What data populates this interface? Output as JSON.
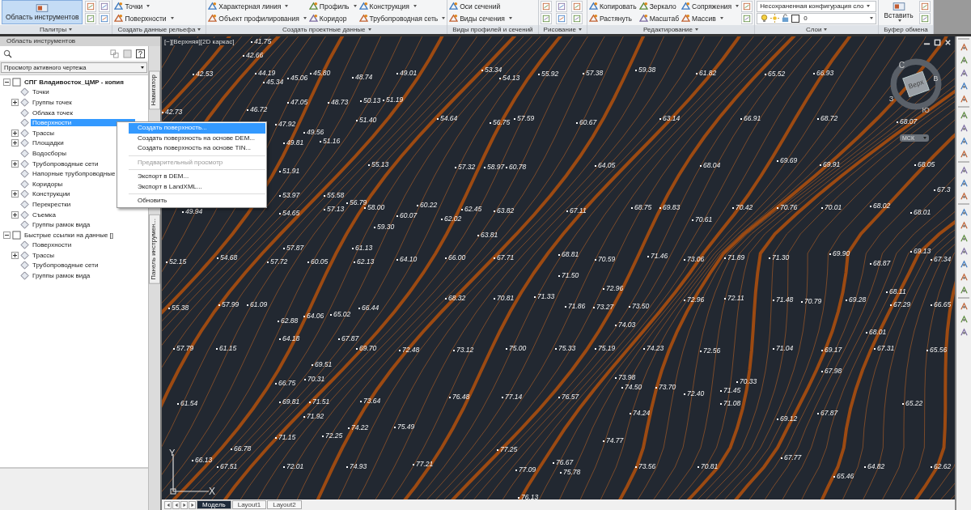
{
  "ribbon": {
    "panels": [
      {
        "title": "Палитры",
        "menu": true,
        "items": [
          {
            "label": "Область инструментов",
            "kind": "large",
            "selected": true,
            "dropdown": false
          }
        ]
      },
      {
        "title": "Создать данные рельефа",
        "menu": true,
        "items": [
          {
            "label": "Точки",
            "kind": "small",
            "dropdown": true
          },
          {
            "label": "Поверхности",
            "kind": "small",
            "dropdown": true
          }
        ]
      },
      {
        "title": "Создать проектные данные",
        "menu": true,
        "items": [
          {
            "label": "Характерная линия",
            "kind": "small",
            "dropdown": true
          },
          {
            "label": "Объект профилирования",
            "kind": "small",
            "dropdown": true
          },
          {
            "label": "Профиль",
            "kind": "small",
            "dropdown": true
          },
          {
            "label": "Коридор",
            "kind": "small",
            "dropdown": false
          },
          {
            "label": "Конструкция",
            "kind": "small",
            "dropdown": true
          },
          {
            "label": "Трубопроводная сеть",
            "kind": "small",
            "dropdown": true
          }
        ]
      },
      {
        "title": "Виды профилей и сечений",
        "menu": false,
        "items": [
          {
            "label": "Оси сечений",
            "kind": "small",
            "dropdown": false
          },
          {
            "label": "Виды сечения",
            "kind": "small",
            "dropdown": true
          }
        ]
      },
      {
        "title": "Рисование",
        "menu": true
      },
      {
        "title": "Редактирование",
        "menu": true,
        "items": [
          {
            "label": "Копировать",
            "kind": "small",
            "dropdown": false
          },
          {
            "label": "Растянуть",
            "kind": "small",
            "dropdown": false
          },
          {
            "label": "Зеркало",
            "kind": "small",
            "dropdown": false
          },
          {
            "label": "Масштаб",
            "kind": "small",
            "dropdown": false
          },
          {
            "label": "Сопряжения",
            "kind": "small",
            "dropdown": true
          },
          {
            "label": "Массив",
            "kind": "small",
            "dropdown": true
          }
        ]
      },
      {
        "title": "Слои",
        "menu": true,
        "items": [
          {
            "label": "Несохраненная конфигурация сло",
            "kind": "combo",
            "dropdown": true
          },
          {
            "label": "0",
            "kind": "layer",
            "dropdown": true
          }
        ]
      },
      {
        "title": "Буфер обмена",
        "menu": false,
        "items": [
          {
            "label": "Вставить",
            "kind": "large",
            "selected": false,
            "dropdown": true
          }
        ]
      }
    ]
  },
  "palette": {
    "title": "Область инструментов",
    "view_select": "Просмотр активного чертежа",
    "side_tabs": [
      "Навигатор",
      "Панель инструмен..."
    ],
    "tree": [
      {
        "label": "СПГ Владивосток_ЦМР - копия",
        "kind": "drawing",
        "expanded": true,
        "selected": false,
        "children": [
          {
            "label": "Точки",
            "selected": false
          },
          {
            "label": "Группы точек",
            "expanded": false,
            "selected": false
          },
          {
            "label": "Облака точек",
            "selected": false
          },
          {
            "label": "Поверхности",
            "selected": true
          },
          {
            "label": "Трассы",
            "expanded": false,
            "selected": false
          },
          {
            "label": "Площадки",
            "expanded": false,
            "selected": false
          },
          {
            "label": "Водосборы",
            "selected": false
          },
          {
            "label": "Трубопроводные сети",
            "expanded": false,
            "selected": false
          },
          {
            "label": "Напорные трубопроводные",
            "selected": false
          },
          {
            "label": "Коридоры",
            "selected": false
          },
          {
            "label": "Конструкции",
            "expanded": false,
            "selected": false
          },
          {
            "label": "Перекрестки",
            "selected": false
          },
          {
            "label": "Съемка",
            "expanded": false,
            "selected": false
          },
          {
            "label": "Группы рамок вида",
            "selected": false
          }
        ]
      },
      {
        "label": "Быстрые ссылки на данные []",
        "kind": "references",
        "expanded": true,
        "selected": false,
        "children": [
          {
            "label": "Поверхности",
            "selected": false
          },
          {
            "label": "Трассы",
            "expanded": false,
            "selected": false
          },
          {
            "label": "Трубопроводные сети",
            "selected": false
          },
          {
            "label": "Группы рамок вида",
            "selected": false
          }
        ]
      }
    ]
  },
  "context_menu": {
    "groups": [
      [
        {
          "label": "Создать поверхность...",
          "selected": true,
          "disabled": false
        },
        {
          "label": "Создать поверхность на основе DEM...",
          "selected": false,
          "disabled": false
        },
        {
          "label": "Создать поверхность на основе TIN...",
          "selected": false,
          "disabled": false
        }
      ],
      [
        {
          "label": "Предварительный просмотр",
          "selected": false,
          "disabled": true
        }
      ],
      [
        {
          "label": "Экспорт в DEM...",
          "selected": false,
          "disabled": false
        },
        {
          "label": "Экспорт в LandXML...",
          "selected": false,
          "disabled": false
        }
      ],
      [
        {
          "label": "Обновить",
          "selected": false,
          "disabled": false
        }
      ]
    ]
  },
  "viewport": {
    "header": "[−][Верхняя][2D каркас]",
    "viewcube": {
      "face": "Верх",
      "directions": [
        "С",
        "В",
        "Ю",
        "З"
      ]
    },
    "ucs_menu": "МСК",
    "ucs_axes": [
      "Y",
      "X"
    ],
    "elevations": [
      "41.75",
      "42.66",
      "42.53",
      "44.19",
      "45.06",
      "45.80",
      "48.74",
      "49.01",
      "53.34",
      "54.13",
      "55.92",
      "57.38",
      "59.38",
      "61.82",
      "65.52",
      "66.93",
      "45.34",
      "42.73",
      "46.72",
      "47.05",
      "48.73",
      "50.13",
      "51.19",
      "54.64",
      "56.75",
      "57.59",
      "60.67",
      "63.14",
      "66.91",
      "68.72",
      "47.92",
      "49.56",
      "51.40",
      "51.16",
      "49.81",
      "68.07",
      "55.13",
      "57.32",
      "58.97",
      "60.78",
      "64.05",
      "68.04",
      "69.69",
      "69.91",
      "68.05",
      "51.91",
      "53.97",
      "55.58",
      "49.94",
      "54.65",
      "57.13",
      "56.79",
      "58.00",
      "60.07",
      "60.22",
      "62.02",
      "62.45",
      "63.82",
      "67.11",
      "68.75",
      "69.83",
      "70.61",
      "70.42",
      "70.76",
      "70.01",
      "68.02",
      "68.01",
      "67.3",
      "59.30",
      "57.87",
      "61.13",
      "63.81",
      "52.15",
      "54.68",
      "57.72",
      "60.05",
      "62.13",
      "64.10",
      "66.00",
      "67.71",
      "68.81",
      "70.59",
      "71.46",
      "73.06",
      "71.89",
      "71.30",
      "69.90",
      "68.87",
      "69.13",
      "67.34",
      "71.50",
      "72.96",
      "55.38",
      "57.99",
      "61.09",
      "62.88",
      "64.06",
      "65.02",
      "66.44",
      "68.32",
      "70.81",
      "71.33",
      "71.86",
      "73.27",
      "73.50",
      "72.96",
      "72.11",
      "71.48",
      "70.79",
      "69.28",
      "68.11",
      "67.29",
      "66.65",
      "74.03",
      "68.01",
      "57.79",
      "61.15",
      "64.18",
      "67.87",
      "69.70",
      "72.48",
      "73.12",
      "75.00",
      "75.33",
      "75.19",
      "74.23",
      "72.56",
      "71.04",
      "69.17",
      "67.31",
      "65.56",
      "69.51",
      "66.75",
      "70.31",
      "67.98",
      "73.98",
      "74.50",
      "73.70",
      "70.33",
      "61.54",
      "69.81",
      "71.51",
      "73.64",
      "76.48",
      "77.14",
      "76.57",
      "72.40",
      "71.45",
      "71.08",
      "65.22",
      "71.92",
      "75.49",
      "74.24",
      "69.12",
      "67.87",
      "74.22",
      "71.15",
      "72.25",
      "74.77",
      "77.25",
      "66.78",
      "66.13",
      "67.51",
      "72.01",
      "74.93",
      "77.21",
      "76.67",
      "75.78",
      "77.09",
      "73.56",
      "70.81",
      "67.77",
      "64.82",
      "62.62",
      "65.46",
      "76.13"
    ],
    "layout_tabs": [
      {
        "label": "Модель",
        "selected": true
      },
      {
        "label": "Layout1",
        "selected": false
      },
      {
        "label": "Layout2",
        "selected": false
      }
    ]
  }
}
